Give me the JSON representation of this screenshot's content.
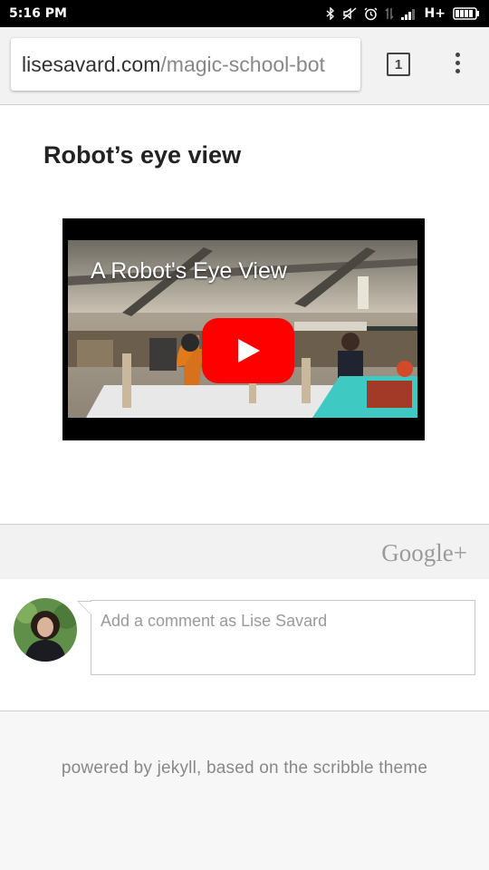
{
  "status_bar": {
    "time": "5:16 PM",
    "network": "H+",
    "icons": [
      "bluetooth-icon",
      "mute-icon",
      "alarm-icon",
      "data-arrows-icon",
      "signal-icon",
      "battery-icon"
    ]
  },
  "browser": {
    "url_host": "lisesavard.com",
    "url_path": "/magic-school-bot",
    "tab_count": "1",
    "menu_icon": "more-vert-icon"
  },
  "post": {
    "title": "Robot’s eye view",
    "video": {
      "title": "A Robot's Eye View",
      "play_icon": "play-icon"
    }
  },
  "comments": {
    "brand": "Google+",
    "placeholder": "Add a comment as Lise Savard"
  },
  "footer": {
    "text": "powered by jekyll, based on the scribble theme"
  },
  "colors": {
    "youtube_red": "#ff0000",
    "status_bar_bg": "#000000",
    "toolbar_bg": "#f2f2f2"
  }
}
